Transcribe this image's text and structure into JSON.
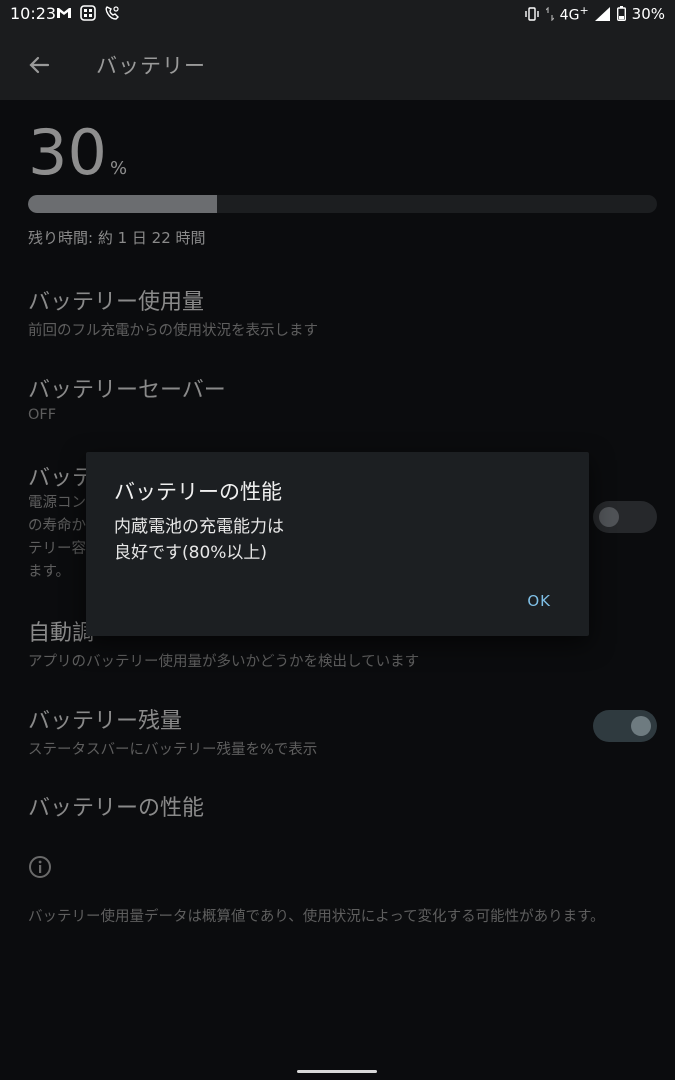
{
  "status_bar": {
    "time": "10:23",
    "network": "4G",
    "network_plus": "+",
    "battery_pct": "30%"
  },
  "app_bar": {
    "title": "バッテリー"
  },
  "battery": {
    "level_number": "30",
    "level_sign": "%",
    "level_fraction": 0.3,
    "remaining": "残り時間: 約 1 日 22 時間"
  },
  "items": {
    "usage_title": "バッテリー使用量",
    "usage_sub": "前回のフル充電からの使用状況を表示します",
    "saver_title": "バッテリーセーバー",
    "saver_sub": "OFF",
    "care_title": "バッテ",
    "care_sub1": "電源コン",
    "care_sub2": "の寿命か",
    "care_sub3": "テリー容",
    "care_sub4": "ます。",
    "auto_title": "自動調",
    "auto_sub": "アプリのバッテリー使用量が多いかどうかを検出しています",
    "percent_title": "バッテリー残量",
    "percent_sub": "ステータスバーにバッテリー残量を%で表示",
    "performance_title": "バッテリーの性能"
  },
  "footnote": "バッテリー使用量データは概算値であり、使用状況によって変化する可能性があります。",
  "dialog": {
    "title": "バッテリーの性能",
    "message": "内蔵電池の充電能力は\n良好です(80%以上)",
    "ok_label": "OK"
  },
  "colors": {
    "accent": "#7fbfe6",
    "background": "#0b0c0e",
    "dialog": "#1c1f22"
  }
}
